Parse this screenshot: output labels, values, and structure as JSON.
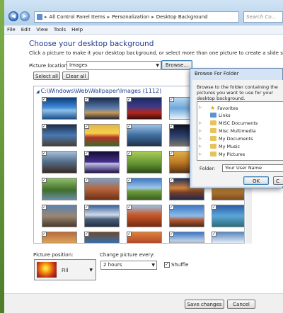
{
  "address": {
    "breadcrumb": [
      "All Control Panel Items",
      "Personalization",
      "Desktop Background"
    ],
    "search_placeholder": "Search Co..."
  },
  "menu": [
    "File",
    "Edit",
    "View",
    "Tools",
    "Help"
  ],
  "page": {
    "title": "Choose your desktop background",
    "subtitle": "Click a picture to make it your desktop background, or select more than one picture to create a slide show.",
    "picture_location_label": "Picture location:",
    "picture_location_value": "Images",
    "browse_label": "Browse...",
    "select_all_label": "Select all",
    "clear_all_label": "Clear all",
    "gallery_header": "C:\\Windows\\Web\\Wallpaper\\Images (1112)"
  },
  "thumbnails": [
    {
      "name": "ocean-sunrise",
      "bg": "linear-gradient(#0d3a78,#3f8ad8 45%,#8bc2ea 60%,#1d4f8a)",
      "checked": true
    },
    {
      "name": "lighthouse-dusk",
      "bg": "linear-gradient(#1a2a4a,#5a7cb0 50%,#c79a5a 70%,#2a2a35)",
      "checked": true
    },
    {
      "name": "red-arch",
      "bg": "linear-gradient(#1c2a58,#3c3a8a 40%,#b4281e 70%,#3a0f0a)",
      "checked": true
    },
    {
      "name": "ice-blue",
      "bg": "linear-gradient(#b8d7f0,#6fa6d8 50%,#e6f2fb)",
      "checked": true
    },
    {
      "name": "harbor-night",
      "bg": "linear-gradient(#0b1b3a,#1f3f78 50%,#c2a055 75%,#0e1424)",
      "checked": true
    },
    {
      "name": "rock-sea",
      "bg": "linear-gradient(#1a2d4c,#4a78b2 50%,#4a4035)",
      "checked": true
    },
    {
      "name": "tulip-field",
      "bg": "linear-gradient(#e1b44a,#f6d14a 40%,#b3322a 60%,#3c6b26)",
      "checked": true
    },
    {
      "name": "mountain-lake",
      "bg": "linear-gradient(#9ec3e8,#3e6e9e 50%,#20344e)",
      "checked": true
    },
    {
      "name": "night-sky",
      "bg": "linear-gradient(#0d1222,#2c416e 55%,#78746a)",
      "checked": true
    },
    {
      "name": "bay-blue",
      "bg": "linear-gradient(#6aa1d6,#1c4f8a 60%,#0e2748)",
      "checked": true
    },
    {
      "name": "lighthouse-rock",
      "bg": "linear-gradient(#a5c0dc,#57718e 45%,#3b2a22)",
      "checked": true
    },
    {
      "name": "lightning-storm",
      "bg": "linear-gradient(#140e34,#47308c 50%,#c5c2ef 55%,#20144a)",
      "checked": true
    },
    {
      "name": "meadow",
      "bg": "linear-gradient(#a9cd5a,#5f8f2f 60%,#2d4a18)",
      "checked": true
    },
    {
      "name": "golden-fields",
      "bg": "linear-gradient(#e0b04a,#c07a24 50%,#5a3414)",
      "checked": true
    },
    {
      "name": "snow-peaks",
      "bg": "linear-gradient(#d6e0ea,#8aa3be 45%,#425671)",
      "checked": true
    },
    {
      "name": "green-valley",
      "bg": "linear-gradient(#8fbf6a,#3f6e2a 55%,#6a8da8)",
      "checked": true
    },
    {
      "name": "canyon",
      "bg": "linear-gradient(#7aa0c8,#b7643a 50%,#6e2e16)",
      "checked": true
    },
    {
      "name": "lone-tree",
      "bg": "linear-gradient(#3b78c4,#9fc7e8 45%,#6e9e3a 60%,#3a5e22)",
      "checked": true
    },
    {
      "name": "sunset-water",
      "bg": "linear-gradient(#1c3060,#d2843a 45%,#7a3f2a 65%,#1d2a48)",
      "checked": true
    },
    {
      "name": "desert-dunes",
      "bg": "linear-gradient(#ecc978,#c98a3a 50%,#7a4a1c)",
      "checked": true
    },
    {
      "name": "rock-pools",
      "bg": "linear-gradient(#5c82b0,#9a8672 50%,#4a3a2c)",
      "checked": true
    },
    {
      "name": "clouds-sky",
      "bg": "linear-gradient(#3a5f9c,#d0dcea 45%,#4a5f7c 65%,#223044)",
      "checked": true
    },
    {
      "name": "red-rocks",
      "bg": "linear-gradient(#9ec0e4,#c6582a 45%,#7a2a12)",
      "checked": true
    },
    {
      "name": "cliff-coast",
      "bg": "linear-gradient(#3c76c4,#8cbce8 50%,#b5562c 70%,#4a2a18)",
      "checked": true
    },
    {
      "name": "blue-lagoon",
      "bg": "linear-gradient(#2a5ca8,#5ca6d8 50%,#2a6e7a)",
      "checked": true
    },
    {
      "name": "wave-rocks",
      "bg": "linear-gradient(#b86a3a,#d8a05a 45%,#5e3420)",
      "checked": true
    },
    {
      "name": "canyon-river",
      "bg": "linear-gradient(#6a4a30,#3a6ea8 50%,#2a3a4a)",
      "checked": true
    },
    {
      "name": "sunset-canyon",
      "bg": "linear-gradient(#e07f3a,#b04a2a 50%,#3a1e16)",
      "checked": true
    },
    {
      "name": "mesa-sky",
      "bg": "linear-gradient(#3e74c0,#b7d0ea 40%,#a8643a 70%)",
      "checked": true
    },
    {
      "name": "coast-row6",
      "bg": "linear-gradient(#5a88c0,#e3ecf5 50%,#8a4a2a)",
      "checked": true
    }
  ],
  "footer": {
    "position_label": "Picture position:",
    "position_value": "Fill",
    "interval_label": "Change picture every:",
    "interval_value": "2 hours",
    "shuffle_label": "Shuffle",
    "shuffle_checked": true,
    "save_label": "Save changes",
    "cancel_label": "Cancel"
  },
  "dialog": {
    "title": "Browse For Folder",
    "instructions": "Browse to the folder containing the pictures you want to use for your desktop background.",
    "tree": [
      {
        "label": "Favorites",
        "icon": "star",
        "expander": true
      },
      {
        "label": "Links",
        "icon": "folder-blue",
        "expander": false
      },
      {
        "label": "MISC Documents",
        "icon": "folder",
        "expander": true
      },
      {
        "label": "Misc Multimedia",
        "icon": "folder",
        "expander": true
      },
      {
        "label": "My Documents",
        "icon": "folder",
        "expander": true
      },
      {
        "label": "My Music",
        "icon": "folder",
        "expander": true
      },
      {
        "label": "My Pictures",
        "icon": "folder",
        "expander": true
      }
    ],
    "folder_label": "Folder:",
    "folder_value": "Your User Name",
    "ok_label": "OK",
    "cancel_label": "C"
  }
}
